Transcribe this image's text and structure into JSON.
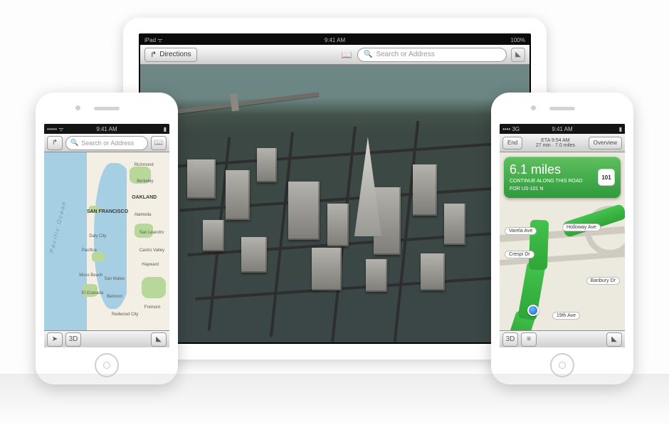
{
  "ipad": {
    "status": {
      "left": "iPad",
      "wifi": "ᯤ",
      "time": "9:41 AM",
      "battery": "100%"
    },
    "toolbar": {
      "directions_label": "Directions",
      "bookmark_glyph": "📖",
      "search_placeholder": "Search or Address"
    }
  },
  "phone_left": {
    "status": {
      "signal": "•••••",
      "wifi": "ᯤ",
      "time": "9:41 AM",
      "battery": "▮"
    },
    "toolbar": {
      "directions_glyph": "↱",
      "search_placeholder": "Search or Address",
      "bookmark_glyph": "📖"
    },
    "bottom": {
      "locate_glyph": "➤",
      "mode_label": "3D"
    },
    "labels": {
      "ocean": "Pacific Ocean",
      "cities": {
        "sf": "SAN FRANCISCO",
        "oakland": "OAKLAND"
      },
      "towns": [
        "Richmond",
        "Berkeley",
        "Alameda",
        "San Leandro",
        "Castro Valley",
        "Daly City",
        "Pacifica",
        "Moss Beach",
        "El Granada",
        "San Mateo",
        "Belmont",
        "Hayward",
        "Fremont",
        "Redwood City"
      ]
    }
  },
  "phone_right": {
    "status": {
      "signal": "••••",
      "carrier": "3G",
      "time": "9:41 AM",
      "battery": "▮"
    },
    "top": {
      "end_label": "End",
      "eta_label": "ETA 9:54 AM",
      "eta_sub": "27 min · 7.0 miles",
      "overview_label": "Overview"
    },
    "hint": {
      "distance": "6.1 miles",
      "line1": "CONTINUE ALONG THIS ROAD",
      "line2": "FOR US-101 N",
      "shield": "101"
    },
    "streets": [
      "Varela Ave",
      "Holloway Ave",
      "Crespi Dr",
      "Banbury Dr",
      "19th Ave"
    ],
    "bottom": {
      "mode_label": "3D",
      "list_glyph": "≡"
    }
  }
}
